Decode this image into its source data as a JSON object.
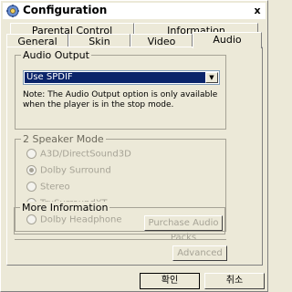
{
  "window": {
    "title": "Configuration",
    "close_glyph": "x"
  },
  "tabs": {
    "back_row": [
      "Parental Control",
      "Information"
    ],
    "front_row": [
      "General",
      "Skin",
      "Video",
      "Audio"
    ],
    "active": "Audio"
  },
  "audio_output": {
    "label": "Audio Output",
    "selected": "Use SPDIF",
    "arrow_glyph": "▼",
    "note": "Note:  The Audio Output option is only available when the player is in the stop mode."
  },
  "speaker_mode": {
    "label": "2 Speaker Mode",
    "options": [
      "A3D/DirectSound3D",
      "Dolby Surround",
      "Stereo",
      "TruSurroundXT",
      "Dolby Headphone"
    ],
    "selected_index": 1,
    "enabled": false
  },
  "more_info": {
    "label": "More Information",
    "purchase_button": "Purchase Audio Packs"
  },
  "advanced_button": "Advanced",
  "footer": {
    "ok": "확인",
    "cancel": "취소"
  },
  "icons": {
    "app": "config-gear-icon",
    "close": "close-icon",
    "dropdown": "chevron-down-icon"
  }
}
